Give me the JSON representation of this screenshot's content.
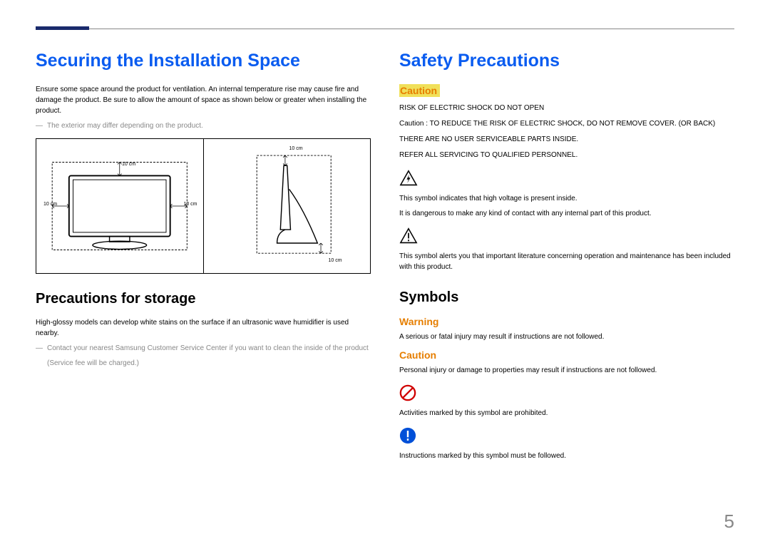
{
  "page_number": "5",
  "left": {
    "heading1": "Securing the Installation Space",
    "intro": "Ensure some space around the product for ventilation. An internal temperature rise may cause fire and damage the product. Be sure to allow the amount of space as shown below or greater when installing the product.",
    "note1": "The exterior may differ depending on the product.",
    "dims": {
      "top": "10 cm",
      "left": "10 cm",
      "right": "10 cm",
      "bottom": "10 cm",
      "side_top": "10 cm",
      "side_bottom": "10 cm"
    },
    "heading2": "Precautions for storage",
    "storage_body": "High-glossy models can develop white stains on the surface if an ultrasonic wave humidifier is used nearby.",
    "storage_note": "Contact your nearest Samsung Customer Service Center if you want to clean the inside of the product",
    "storage_note_sub": "(Service fee will be charged.)"
  },
  "right": {
    "heading1": "Safety Precautions",
    "caution_label": "Caution",
    "caution_lines": {
      "l1": "RISK OF ELECTRIC SHOCK DO NOT OPEN",
      "l2": "Caution : TO REDUCE THE RISK OF ELECTRIC SHOCK, DO NOT REMOVE COVER. (OR BACK)",
      "l3": "THERE ARE NO USER SERVICEABLE PARTS INSIDE.",
      "l4": "REFER ALL SERVICING TO QUALIFIED PERSONNEL."
    },
    "hv_symbol_line1": "This symbol indicates that high voltage is present inside.",
    "hv_symbol_line2": "It is dangerous to make any kind of contact with any internal part of this product.",
    "lit_symbol": "This symbol alerts you that important literature concerning operation and maintenance has been included with this product.",
    "heading2": "Symbols",
    "warning_label": "Warning",
    "warning_body": "A serious or fatal injury may result if instructions are not followed.",
    "caution2_label": "Caution",
    "caution2_body": "Personal injury or damage to properties may result if instructions are not followed.",
    "prohibit_body": "Activities marked by this symbol are prohibited.",
    "follow_body": "Instructions marked by this symbol must be followed."
  }
}
